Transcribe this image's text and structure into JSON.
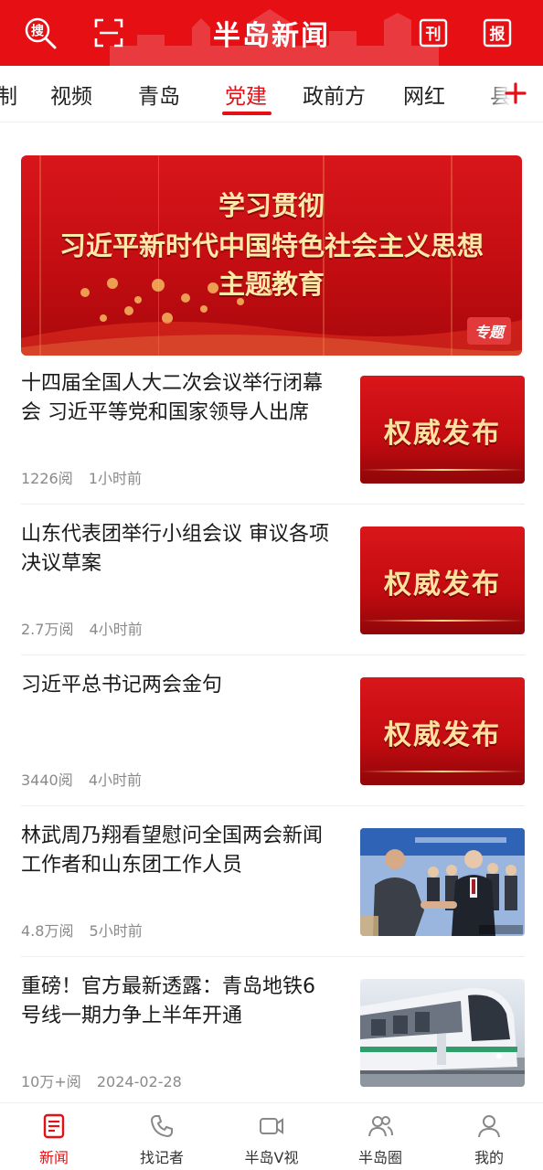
{
  "header": {
    "logo_text": "半岛新闻",
    "search_icon_label": "搜",
    "kan_label": "刊",
    "bao_label": "报"
  },
  "tabs": [
    {
      "label": "制"
    },
    {
      "label": "视频"
    },
    {
      "label": "青岛"
    },
    {
      "label": "党建"
    },
    {
      "label": "政前方"
    },
    {
      "label": "网红"
    },
    {
      "label": "县"
    }
  ],
  "active_tab_index": 3,
  "banner": {
    "line1": "学习贯彻",
    "line2": "习近平新时代中国特色社会主义思想",
    "line3": "主题教育",
    "tag": "专题"
  },
  "news": [
    {
      "title": "十四届全国人大二次会议举行闭幕会 习近平等党和国家领导人出席",
      "reads": "1226阅",
      "time": "1小时前",
      "thumb_text": "权威发布"
    },
    {
      "title": "山东代表团举行小组会议 审议各项决议草案",
      "reads": "2.7万阅",
      "time": "4小时前",
      "thumb_text": "权威发布"
    },
    {
      "title": "习近平总书记两会金句",
      "reads": "3440阅",
      "time": "4小时前",
      "thumb_text": "权威发布"
    },
    {
      "title": "林武周乃翔看望慰问全国两会新闻工作者和山东团工作人员",
      "reads": "4.8万阅",
      "time": "5小时前",
      "thumb_text": ""
    },
    {
      "title": "重磅！官方最新透露：青岛地铁6号线一期力争上半年开通",
      "reads": "10万+阅",
      "time": "2024-02-28",
      "thumb_text": ""
    }
  ],
  "bottom_nav": [
    {
      "label": "新闻",
      "icon": "news-icon",
      "active": true
    },
    {
      "label": "找记者",
      "icon": "phone-icon",
      "active": false
    },
    {
      "label": "半岛V视",
      "icon": "video-icon",
      "active": false
    },
    {
      "label": "半岛圈",
      "icon": "people-icon",
      "active": false
    },
    {
      "label": "我的",
      "icon": "user-icon",
      "active": false
    }
  ],
  "colors": {
    "brand_red": "#e50f14",
    "text_dark": "#1a1a1a",
    "meta_gray": "#8a8a8a"
  }
}
